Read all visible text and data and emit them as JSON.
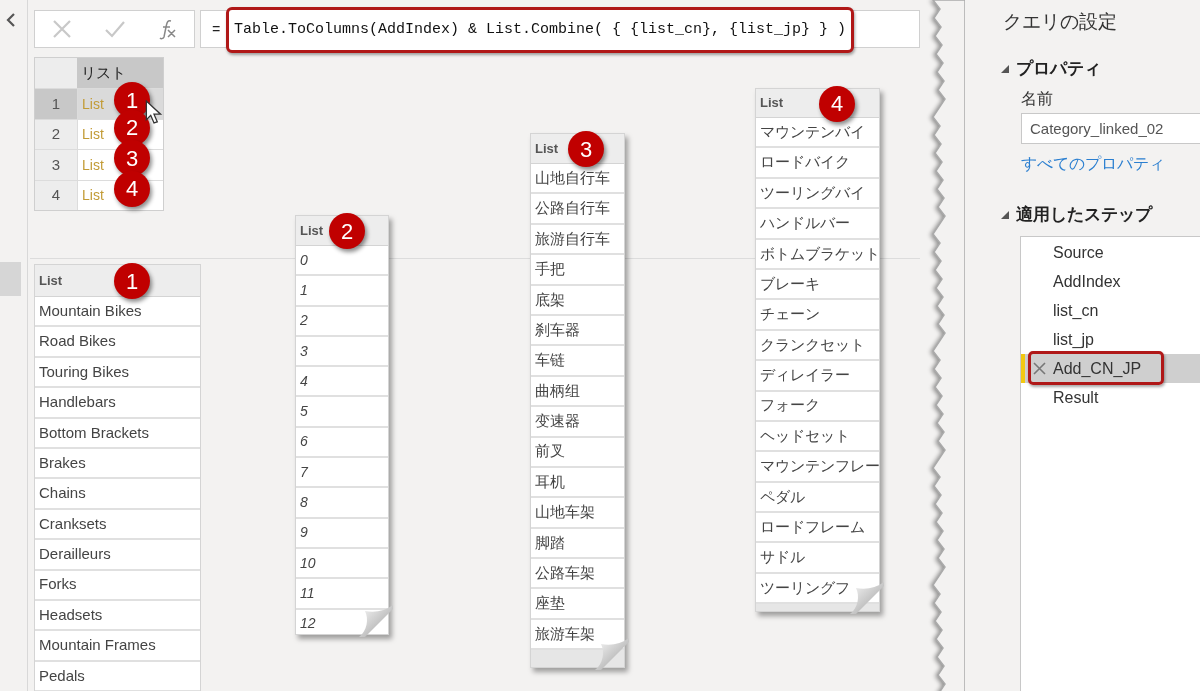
{
  "formula_bar": {
    "equals": "=",
    "formula": "Table.ToColumns(AddIndex) & List.Combine( { {list_cn}, {list_jp} } )",
    "highlighted": true
  },
  "preview_table": {
    "column": "リスト",
    "rows": [
      {
        "index": "1",
        "value": "List",
        "badge": "1",
        "selected": true
      },
      {
        "index": "2",
        "value": "List",
        "badge": "2",
        "selected": false
      },
      {
        "index": "3",
        "value": "List",
        "badge": "3",
        "selected": false
      },
      {
        "index": "4",
        "value": "List",
        "badge": "4",
        "selected": false
      }
    ]
  },
  "lists": [
    {
      "header": "List",
      "badge": "1",
      "kind": "text",
      "items": [
        "Mountain Bikes",
        "Road Bikes",
        "Touring Bikes",
        "Handlebars",
        "Bottom Brackets",
        "Brakes",
        "Chains",
        "Cranksets",
        "Derailleurs",
        "Forks",
        "Headsets",
        "Mountain Frames",
        "Pedals"
      ]
    },
    {
      "header": "List",
      "badge": "2",
      "kind": "number",
      "items": [
        "0",
        "1",
        "2",
        "3",
        "4",
        "5",
        "6",
        "7",
        "8",
        "9",
        "10",
        "11",
        "12"
      ]
    },
    {
      "header": "List",
      "badge": "3",
      "kind": "text",
      "items": [
        "山地自行车",
        "公路自行车",
        "旅游自行车",
        "手把",
        "底架",
        "刹车器",
        "车链",
        "曲柄组",
        "变速器",
        "前叉",
        "耳机",
        "山地车架",
        "脚踏",
        "公路车架",
        "座垫",
        "旅游车架"
      ]
    },
    {
      "header": "List",
      "badge": "4",
      "kind": "text",
      "items": [
        "マウンテンバイ",
        "ロードバイク",
        "ツーリングバイ",
        "ハンドルバー",
        "ボトムブラケット",
        "ブレーキ",
        "チェーン",
        "クランクセット",
        "ディレイラー",
        "フォーク",
        "ヘッドセット",
        "マウンテンフレー",
        "ペダル",
        "ロードフレーム",
        "サドル",
        "ツーリングフ"
      ]
    }
  ],
  "query_settings": {
    "title": "クエリの設定",
    "properties": {
      "heading": "プロパティ",
      "expanded": true,
      "name_label": "名前",
      "name_value": "Category_linked_02",
      "all_properties_link": "すべてのプロパティ"
    },
    "applied_steps": {
      "heading": "適用したステップ",
      "expanded": true,
      "steps": [
        {
          "label": "Source",
          "selected": false,
          "highlighted": false
        },
        {
          "label": "AddIndex",
          "selected": false,
          "highlighted": false
        },
        {
          "label": "list_cn",
          "selected": false,
          "highlighted": false
        },
        {
          "label": "list_jp",
          "selected": false,
          "highlighted": false
        },
        {
          "label": "Add_CN_JP",
          "selected": true,
          "highlighted": true
        },
        {
          "label": "Result",
          "selected": false,
          "highlighted": false
        }
      ]
    }
  }
}
